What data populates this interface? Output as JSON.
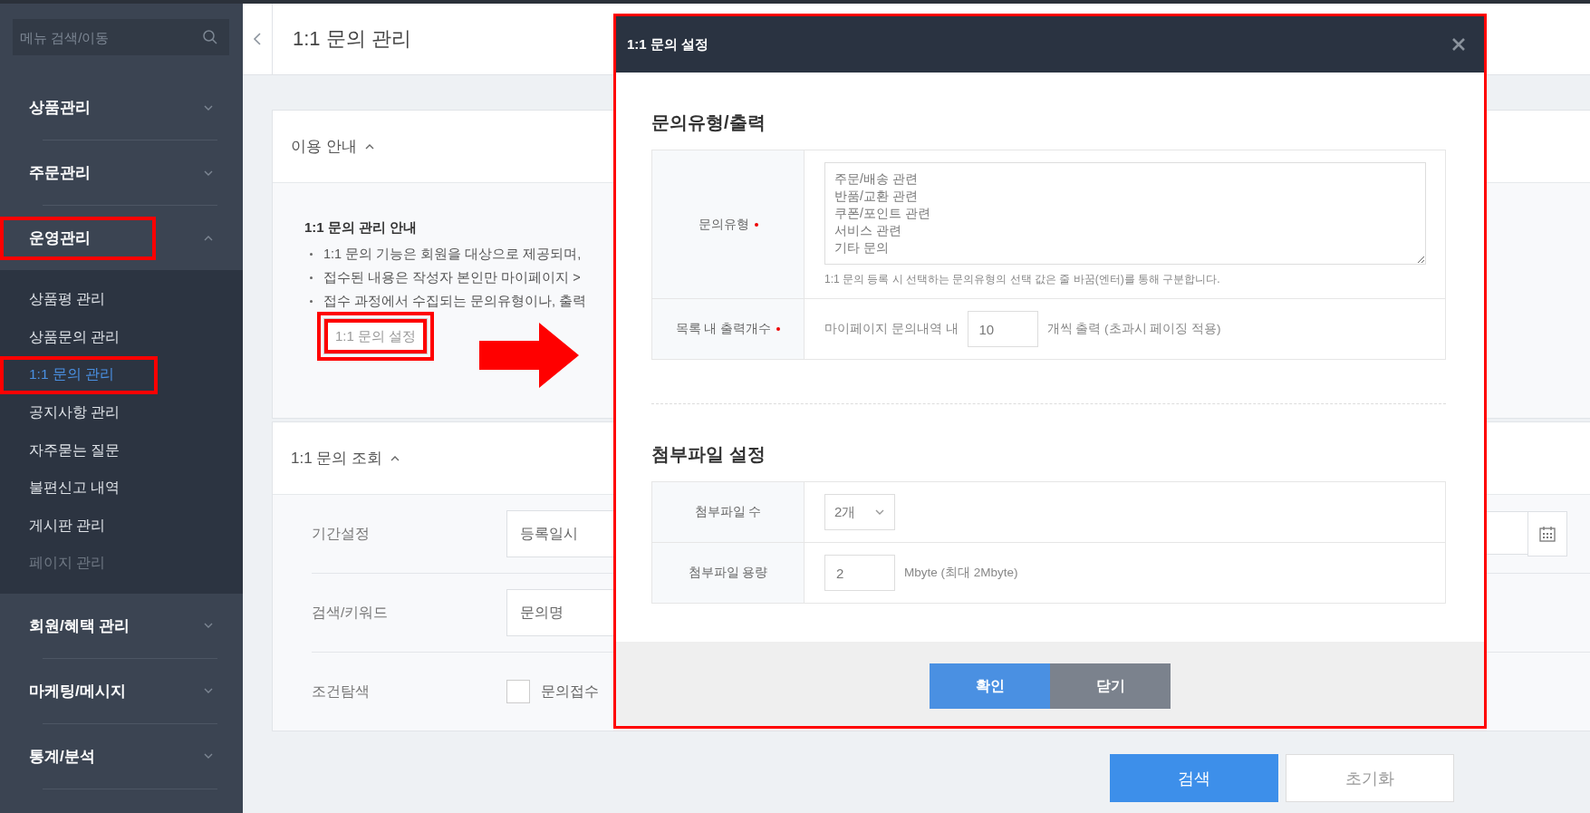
{
  "sidebar": {
    "search_placeholder": "메뉴 검색/이동",
    "menu": [
      {
        "label": "상품관리",
        "expanded": false,
        "highlighted": false
      },
      {
        "label": "주문관리",
        "expanded": false,
        "highlighted": false
      },
      {
        "label": "운영관리",
        "expanded": true,
        "highlighted": true,
        "children": [
          {
            "label": "상품평 관리",
            "selected": false,
            "disabled": false,
            "highlighted": false
          },
          {
            "label": "상품문의 관리",
            "selected": false,
            "disabled": false,
            "highlighted": false
          },
          {
            "label": "1:1 문의 관리",
            "selected": true,
            "disabled": false,
            "highlighted": true
          },
          {
            "label": "공지사항 관리",
            "selected": false,
            "disabled": false,
            "highlighted": false
          },
          {
            "label": "자주묻는 질문",
            "selected": false,
            "disabled": false,
            "highlighted": false
          },
          {
            "label": "불편신고 내역",
            "selected": false,
            "disabled": false,
            "highlighted": false
          },
          {
            "label": "게시판 관리",
            "selected": false,
            "disabled": false,
            "highlighted": false
          },
          {
            "label": "페이지 관리",
            "selected": false,
            "disabled": true,
            "highlighted": false
          }
        ]
      },
      {
        "label": "회원/혜택 관리",
        "expanded": false,
        "highlighted": false
      },
      {
        "label": "마케팅/메시지",
        "expanded": false,
        "highlighted": false
      },
      {
        "label": "통계/분석",
        "expanded": false,
        "highlighted": false
      }
    ]
  },
  "page": {
    "title": "1:1 문의 관리"
  },
  "guide_card": {
    "title": "이용 안내",
    "expanded": true,
    "heading": "1:1 문의 관리 안내",
    "bullets": [
      "1:1 문의 기능은 회원을 대상으로 제공되며,",
      "접수된 내용은 작성자 본인만 마이페이지 >",
      "접수 과정에서 수집되는 문의유형이나, 출력"
    ],
    "button": {
      "label": "1:1 문의 설정",
      "highlighted": true
    }
  },
  "search_card": {
    "title": "1:1 문의 조회",
    "expanded": true,
    "rows": [
      {
        "kind": "date",
        "label": "기간설정",
        "value": "등록일시"
      },
      {
        "kind": "select",
        "label": "검색/키워드",
        "value": "문의명"
      },
      {
        "kind": "checkbox",
        "label": "조건탐색",
        "option": "문의접수",
        "checked": false
      }
    ]
  },
  "actions": [
    {
      "label": "검색",
      "primary": true
    },
    {
      "label": "초기화",
      "primary": false
    }
  ],
  "annotation_arrow": true,
  "modal": {
    "title": "1:1 문의 설정",
    "highlighted": true,
    "sections": [
      {
        "title": "문의유형/출력",
        "rows": [
          {
            "kind": "textarea",
            "label": "문의유형",
            "required": true,
            "lines": [
              "주문/배송 관련",
              "반품/교환 관련",
              "쿠폰/포인트 관련",
              "서비스 관련",
              "기타 문의"
            ],
            "hint": "1:1 문의 등록 시 선택하는 문의유형의 선택 값은 줄 바꿈(엔터)를 통해 구분합니다."
          },
          {
            "kind": "number",
            "label": "목록 내 출력개수",
            "required": true,
            "prefix": "마이페이지 문의내역 내",
            "value": "10",
            "suffix": "개씩 출력 (초과시 페이징 적용)"
          }
        ]
      },
      {
        "title": "첨부파일 설정",
        "rows": [
          {
            "kind": "select",
            "label": "첨부파일 수",
            "required": false,
            "value": "2개"
          },
          {
            "kind": "number",
            "label": "첨부파일 용량",
            "required": false,
            "value": "2",
            "suffix": "Mbyte (최대 2Mbyte)"
          }
        ]
      }
    ],
    "buttons": [
      {
        "label": "확인",
        "primary": true
      },
      {
        "label": "닫기",
        "primary": false
      }
    ]
  }
}
